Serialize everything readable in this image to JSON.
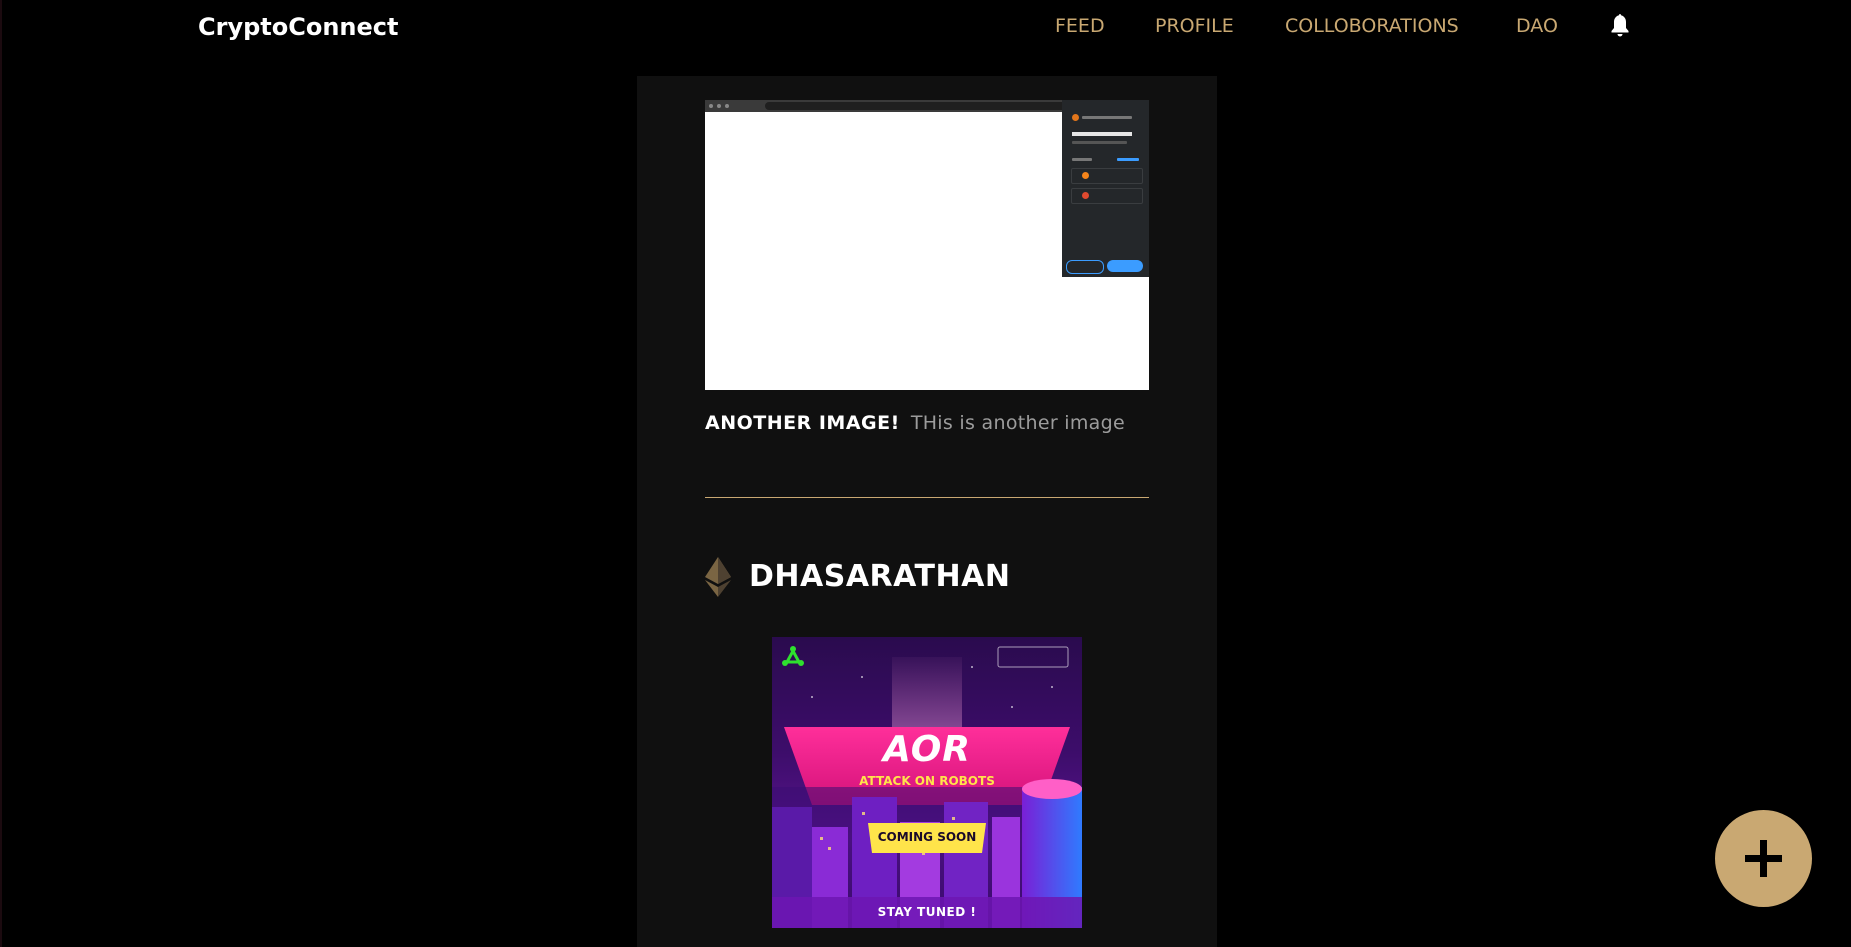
{
  "app": {
    "name": "CryptoConnect"
  },
  "nav": {
    "feed": "FEED",
    "profile": "PROFILE",
    "collaborations": "COLLOBORATIONS",
    "dao": "DAO"
  },
  "icons": {
    "notifications": "bell-icon",
    "author_avatar": "ethereum-icon",
    "create_post": "plus-icon"
  },
  "colors": {
    "background": "#000000",
    "card": "#101010",
    "accent": "#c9a872",
    "muted_text": "#9c9c9c"
  },
  "posts": [
    {
      "title": "ANOTHER IMAGE!",
      "description": "THis is another image"
    },
    {
      "author": "DHASARATHAN",
      "poster": {
        "headline": "AOR",
        "subtitle": "ATTACK ON ROBOTS",
        "badge": "COMING SOON",
        "footer": "STAY TUNED !"
      }
    }
  ]
}
